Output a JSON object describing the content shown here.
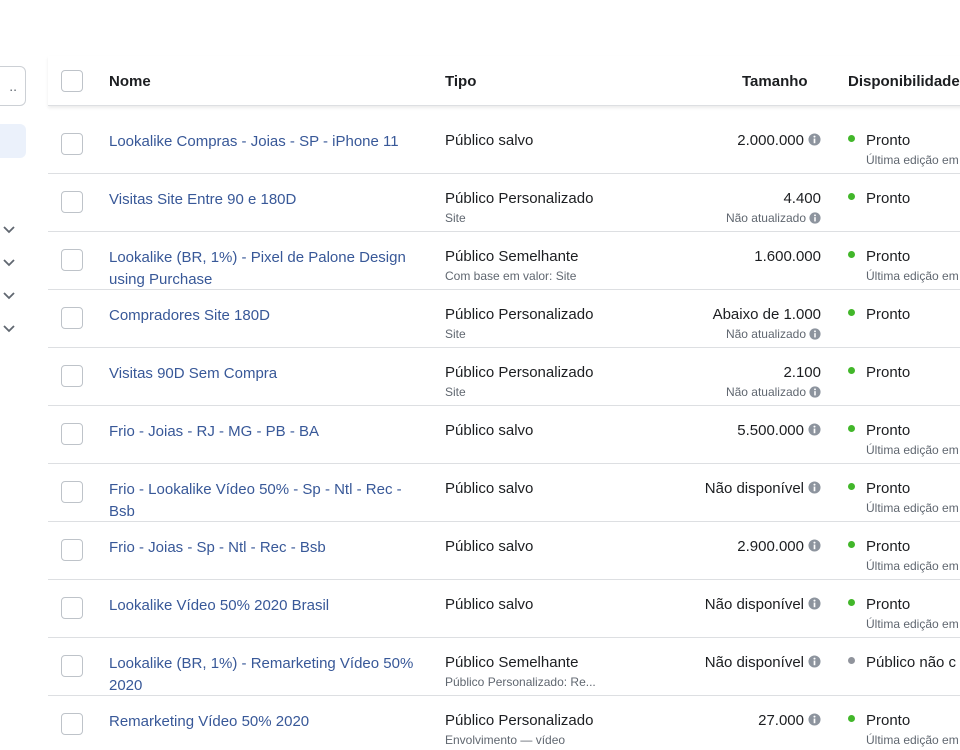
{
  "colors": {
    "link": "#385898",
    "ready_dot": "#42b72a",
    "not_ready_dot": "#90949c"
  },
  "sidebar": {
    "search_value": "..",
    "chevrons": [
      "chevron-down-icon",
      "chevron-down-icon",
      "chevron-down-icon",
      "chevron-down-icon"
    ]
  },
  "table": {
    "headers": {
      "nome": "Nome",
      "tipo": "Tipo",
      "tamanho": "Tamanho",
      "disponibilidade": "Disponibilidade"
    },
    "rows": [
      {
        "name": "Lookalike Compras - Joias - SP - iPhone 11",
        "tipo": "Público salvo",
        "tipo_sub": "",
        "size": "2.000.000",
        "size_sub": "",
        "size_info": true,
        "avail": "Pronto",
        "avail_sub": "Última edição em",
        "avail_status": "ready"
      },
      {
        "name": "Visitas Site Entre 90 e 180D",
        "tipo": "Público Personalizado",
        "tipo_sub": "Site",
        "size": "4.400",
        "size_sub": "Não atualizado",
        "size_info": false,
        "avail": "Pronto",
        "avail_sub": "",
        "avail_status": "ready"
      },
      {
        "name": "Lookalike (BR, 1%) - Pixel de Palone Design using Purchase",
        "tipo": "Público Semelhante",
        "tipo_sub": "Com base em valor: Site",
        "size": "1.600.000",
        "size_sub": "",
        "size_info": false,
        "avail": "Pronto",
        "avail_sub": "Última edição em",
        "avail_status": "ready"
      },
      {
        "name": "Compradores Site 180D",
        "tipo": "Público Personalizado",
        "tipo_sub": "Site",
        "size": "Abaixo de 1.000",
        "size_sub": "Não atualizado",
        "size_info": false,
        "avail": "Pronto",
        "avail_sub": "",
        "avail_status": "ready"
      },
      {
        "name": "Visitas 90D Sem Compra",
        "tipo": "Público Personalizado",
        "tipo_sub": "Site",
        "size": "2.100",
        "size_sub": "Não atualizado",
        "size_info": false,
        "avail": "Pronto",
        "avail_sub": "",
        "avail_status": "ready"
      },
      {
        "name": "Frio - Joias - RJ - MG - PB - BA",
        "tipo": "Público salvo",
        "tipo_sub": "",
        "size": "5.500.000",
        "size_sub": "",
        "size_info": true,
        "avail": "Pronto",
        "avail_sub": "Última edição em",
        "avail_status": "ready"
      },
      {
        "name": "Frio - Lookalike Vídeo 50% - Sp - Ntl - Rec - Bsb",
        "tipo": "Público salvo",
        "tipo_sub": "",
        "size": "Não disponível",
        "size_sub": "",
        "size_info": true,
        "avail": "Pronto",
        "avail_sub": "Última edição em",
        "avail_status": "ready"
      },
      {
        "name": "Frio - Joias - Sp - Ntl - Rec - Bsb",
        "tipo": "Público salvo",
        "tipo_sub": "",
        "size": "2.900.000",
        "size_sub": "",
        "size_info": true,
        "avail": "Pronto",
        "avail_sub": "Última edição em",
        "avail_status": "ready"
      },
      {
        "name": "Lookalike Vídeo 50% 2020 Brasil",
        "tipo": "Público salvo",
        "tipo_sub": "",
        "size": "Não disponível",
        "size_sub": "",
        "size_info": true,
        "avail": "Pronto",
        "avail_sub": "Última edição em",
        "avail_status": "ready"
      },
      {
        "name": "Lookalike (BR, 1%) - Remarketing Vídeo 50% 2020",
        "tipo": "Público Semelhante",
        "tipo_sub": "Público Personalizado: Re...",
        "size": "Não disponível",
        "size_sub": "",
        "size_info": true,
        "avail": "Público não c",
        "avail_sub": "",
        "avail_status": "not_ready"
      },
      {
        "name": "Remarketing Vídeo 50% 2020",
        "tipo": "Público Personalizado",
        "tipo_sub": "Envolvimento — vídeo",
        "size": "27.000",
        "size_sub": "",
        "size_info": true,
        "avail": "Pronto",
        "avail_sub": "Última edição em",
        "avail_status": "ready"
      }
    ]
  }
}
